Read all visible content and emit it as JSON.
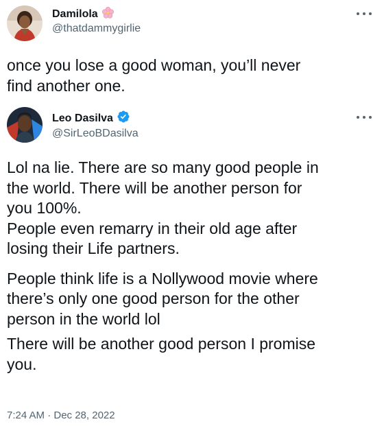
{
  "tweet1": {
    "display_name": "Damilola",
    "name_emoji_icon": "cherry-blossom-icon",
    "handle": "@thatdammygirlie",
    "text_lines": [
      "once you lose a good woman, you’ll never",
      "find another one."
    ]
  },
  "tweet2": {
    "display_name": "Leo Dasilva",
    "verified_icon": "verified-badge-icon",
    "handle": "@SirLeoBDasilva",
    "paragraphs": [
      [
        "Lol na lie. There are so many good people in",
        "the world. There will be another person for",
        "you 100%.",
        "People even remarry in their old age after",
        "losing their Life partners."
      ],
      [
        "People think life is a Nollywood movie where",
        "there’s only one good person for the other",
        "person in the world lol"
      ],
      [
        "There will be another good person I promise",
        "you."
      ]
    ],
    "timestamp": "7:24 AM · Dec 28, 2022"
  },
  "colors": {
    "text": "#0f1419",
    "secondary": "#536471",
    "verified": "#1d9bf0"
  }
}
